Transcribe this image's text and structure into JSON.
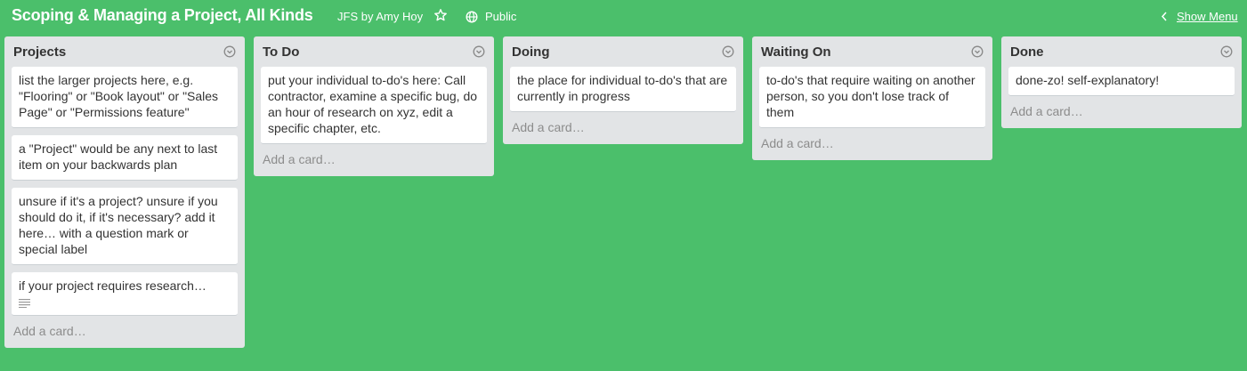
{
  "header": {
    "board_title": "Scoping & Managing a Project, All Kinds",
    "org": "JFS by Amy Hoy",
    "visibility": "Public",
    "show_menu": "Show Menu"
  },
  "lists": [
    {
      "title": "Projects",
      "cards": [
        "list the larger projects here, e.g. \"Flooring\" or \"Book layout\" or \"Sales Page\" or \"Permissions feature\"",
        "a \"Project\" would be any next to last item on your backwards plan",
        "unsure if it's a project? unsure if you should do it, if it's necessary? add it here… with a question mark or special label",
        "if your project requires research…"
      ],
      "add_card": "Add a card…"
    },
    {
      "title": "To Do",
      "cards": [
        "put your individual to-do's here: Call contractor, examine a specific bug, do an hour of research on xyz, edit a specific chapter, etc."
      ],
      "add_card": "Add a card…"
    },
    {
      "title": "Doing",
      "cards": [
        "the place for individual to-do's that are currently in progress"
      ],
      "add_card": "Add a card…"
    },
    {
      "title": "Waiting On",
      "cards": [
        "to-do's that require waiting on another person, so you don't lose track of them"
      ],
      "add_card": "Add a card…"
    },
    {
      "title": "Done",
      "cards": [
        "done-zo! self-explanatory!"
      ],
      "add_card": "Add a card…"
    }
  ],
  "icons": {
    "star": "star-icon",
    "visibility": "globe-icon",
    "menu": "chevron-left-icon",
    "list_menu": "circle-chevron-down-icon",
    "description": "description-lines-icon"
  }
}
